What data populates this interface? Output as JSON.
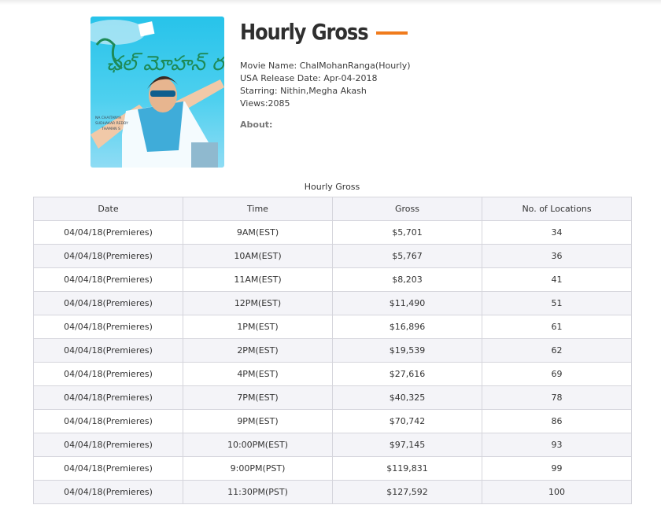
{
  "header": {
    "title": "Hourly Gross",
    "accent_color": "#f07b1d"
  },
  "movie": {
    "name_line": "Movie Name: ChalMohanRanga(Hourly)",
    "release_line": "USA Release Date: Apr-04-2018",
    "starring_line": "Starring: Nithin,Megha Akash",
    "views_line": "Views:2085",
    "about_label": "About:"
  },
  "poster": {
    "telugu_title": "ఛల్ మోహన్ రంగ",
    "credit_lines": [
      "NA CHAITANYA",
      "SUDHAKAR REDDY",
      "THAMAN S"
    ]
  },
  "table": {
    "caption": "Hourly Gross",
    "headers": [
      "Date",
      "Time",
      "Gross",
      "No. of Locations"
    ],
    "rows": [
      [
        "04/04/18(Premieres)",
        "9AM(EST)",
        "$5,701",
        "34"
      ],
      [
        "04/04/18(Premieres)",
        "10AM(EST)",
        "$5,767",
        "36"
      ],
      [
        "04/04/18(Premieres)",
        "11AM(EST)",
        "$8,203",
        "41"
      ],
      [
        "04/04/18(Premieres)",
        "12PM(EST)",
        "$11,490",
        "51"
      ],
      [
        "04/04/18(Premieres)",
        "1PM(EST)",
        "$16,896",
        "61"
      ],
      [
        "04/04/18(Premieres)",
        "2PM(EST)",
        "$19,539",
        "62"
      ],
      [
        "04/04/18(Premieres)",
        "4PM(EST)",
        "$27,616",
        "69"
      ],
      [
        "04/04/18(Premieres)",
        "7PM(EST)",
        "$40,325",
        "78"
      ],
      [
        "04/04/18(Premieres)",
        "9PM(EST)",
        "$70,742",
        "86"
      ],
      [
        "04/04/18(Premieres)",
        "10:00PM(EST)",
        "$97,145",
        "93"
      ],
      [
        "04/04/18(Premieres)",
        "9:00PM(PST)",
        "$119,831",
        "99"
      ],
      [
        "04/04/18(Premieres)",
        "11:30PM(PST)",
        "$127,592",
        "100"
      ]
    ]
  }
}
